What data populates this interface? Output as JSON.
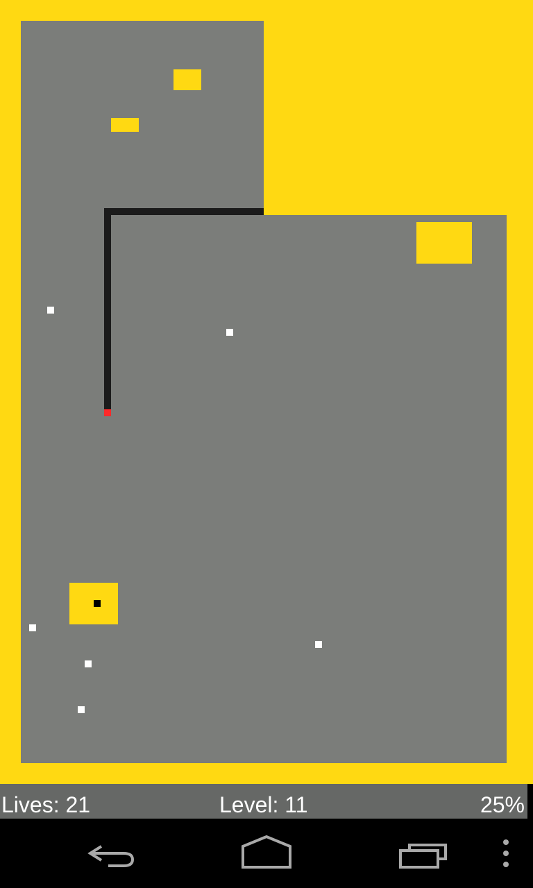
{
  "colors": {
    "claimed": "#ffd912",
    "unclaimed": "#7b7d7a",
    "trail": "#1b1b1b",
    "player_tip": "#ff2a2a",
    "ball": "#ffffff",
    "enemy": "#000000",
    "status_bg": "#666866",
    "status_text": "#ffffff",
    "nav_bg": "#000000",
    "nav_icon": "#a9a9a9"
  },
  "status": {
    "lives": "Lives: 21",
    "level": "Level: 11",
    "percent": "25%"
  },
  "navbar": {
    "back_icon": "back-arrow-icon",
    "home_icon": "home-icon",
    "recents_icon": "recent-apps-icon",
    "menu_icon": "overflow-menu-icon"
  }
}
